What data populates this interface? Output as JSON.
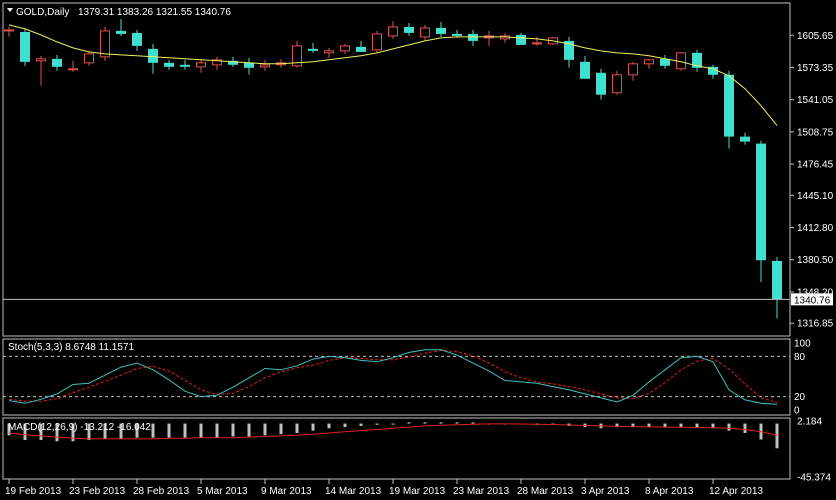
{
  "window": {
    "symbol_header": "GOLD,Daily",
    "ohlc_header": "1379.31 1383.26 1321.55 1340.76"
  },
  "colors": {
    "background": "#000000",
    "grid_frame": "#c0c0c0",
    "bull_candle": "#e05050",
    "bear_candle": "#40e0d0",
    "moving_average": "#f0f060",
    "stoch_main": "#40c0c0",
    "stoch_signal": "#e02020",
    "macd_hist": "#c0c0c0",
    "macd_signal": "#e02020",
    "price_tag_bg": "#ffffff",
    "price_tag_text": "#000000"
  },
  "main_axis": {
    "tick_labels": [
      "1605.65",
      "1573.35",
      "1541.05",
      "1508.75",
      "1476.45",
      "1445.10",
      "1412.80",
      "1380.50",
      "1348.20",
      "1316.85"
    ],
    "tick_values": [
      1605.65,
      1573.35,
      1541.05,
      1508.75,
      1476.45,
      1445.1,
      1412.8,
      1380.5,
      1348.2,
      1316.85
    ],
    "current_price_label": "1340.76",
    "current_price": 1340.76
  },
  "chart_data": {
    "type": "candlestick",
    "title": "GOLD,Daily",
    "subtitle": "1379.31 1383.26 1321.55 1340.76",
    "x_tick_labels": [
      "19 Feb 2013",
      "23 Feb 2013",
      "28 Feb 2013",
      "5 Mar 2013",
      "9 Mar 2013",
      "14 Mar 2013",
      "19 Mar 2013",
      "23 Mar 2013",
      "28 Mar 2013",
      "3 Apr 2013",
      "8 Apr 2013",
      "12 Apr 2013"
    ],
    "x_tick_index": [
      0,
      4,
      8,
      12,
      16,
      20,
      24,
      28,
      32,
      36,
      40,
      44
    ],
    "ylim": [
      1306,
      1635
    ],
    "candles": [
      {
        "o": 1610,
        "h": 1614,
        "l": 1604,
        "c": 1611
      },
      {
        "o": 1609,
        "h": 1612,
        "l": 1575,
        "c": 1579
      },
      {
        "o": 1580,
        "h": 1585,
        "l": 1555,
        "c": 1582
      },
      {
        "o": 1582,
        "h": 1586,
        "l": 1570,
        "c": 1574
      },
      {
        "o": 1572,
        "h": 1580,
        "l": 1569,
        "c": 1572
      },
      {
        "o": 1578,
        "h": 1590,
        "l": 1575,
        "c": 1587
      },
      {
        "o": 1584,
        "h": 1614,
        "l": 1580,
        "c": 1610
      },
      {
        "o": 1610,
        "h": 1622,
        "l": 1605,
        "c": 1607
      },
      {
        "o": 1608,
        "h": 1611,
        "l": 1590,
        "c": 1595
      },
      {
        "o": 1592,
        "h": 1597,
        "l": 1567,
        "c": 1578
      },
      {
        "o": 1578,
        "h": 1581,
        "l": 1571,
        "c": 1574
      },
      {
        "o": 1576,
        "h": 1581,
        "l": 1571,
        "c": 1574
      },
      {
        "o": 1574,
        "h": 1581,
        "l": 1568,
        "c": 1578
      },
      {
        "o": 1576,
        "h": 1584,
        "l": 1571,
        "c": 1581
      },
      {
        "o": 1580,
        "h": 1584,
        "l": 1574,
        "c": 1576
      },
      {
        "o": 1578,
        "h": 1583,
        "l": 1566,
        "c": 1573
      },
      {
        "o": 1574,
        "h": 1581,
        "l": 1570,
        "c": 1576
      },
      {
        "o": 1576,
        "h": 1582,
        "l": 1573,
        "c": 1578
      },
      {
        "o": 1575,
        "h": 1600,
        "l": 1573,
        "c": 1595
      },
      {
        "o": 1592,
        "h": 1598,
        "l": 1588,
        "c": 1590
      },
      {
        "o": 1588,
        "h": 1593,
        "l": 1583,
        "c": 1590
      },
      {
        "o": 1590,
        "h": 1597,
        "l": 1587,
        "c": 1595
      },
      {
        "o": 1594,
        "h": 1600,
        "l": 1589,
        "c": 1589
      },
      {
        "o": 1591,
        "h": 1610,
        "l": 1588,
        "c": 1607
      },
      {
        "o": 1605,
        "h": 1620,
        "l": 1602,
        "c": 1614
      },
      {
        "o": 1614,
        "h": 1618,
        "l": 1605,
        "c": 1608
      },
      {
        "o": 1604,
        "h": 1616,
        "l": 1600,
        "c": 1613
      },
      {
        "o": 1613,
        "h": 1619,
        "l": 1604,
        "c": 1607
      },
      {
        "o": 1607,
        "h": 1611,
        "l": 1603,
        "c": 1605
      },
      {
        "o": 1607,
        "h": 1611,
        "l": 1595,
        "c": 1600
      },
      {
        "o": 1603,
        "h": 1610,
        "l": 1595,
        "c": 1605
      },
      {
        "o": 1602,
        "h": 1608,
        "l": 1598,
        "c": 1605
      },
      {
        "o": 1606,
        "h": 1608,
        "l": 1596,
        "c": 1596
      },
      {
        "o": 1597,
        "h": 1604,
        "l": 1595,
        "c": 1598
      },
      {
        "o": 1597,
        "h": 1604,
        "l": 1596,
        "c": 1603
      },
      {
        "o": 1600,
        "h": 1604,
        "l": 1573,
        "c": 1581
      },
      {
        "o": 1579,
        "h": 1585,
        "l": 1562,
        "c": 1562
      },
      {
        "o": 1568,
        "h": 1572,
        "l": 1541,
        "c": 1546
      },
      {
        "o": 1548,
        "h": 1570,
        "l": 1546,
        "c": 1566
      },
      {
        "o": 1566,
        "h": 1579,
        "l": 1560,
        "c": 1577
      },
      {
        "o": 1577,
        "h": 1582,
        "l": 1572,
        "c": 1581
      },
      {
        "o": 1582,
        "h": 1586,
        "l": 1572,
        "c": 1575
      },
      {
        "o": 1572,
        "h": 1589,
        "l": 1570,
        "c": 1588
      },
      {
        "o": 1588,
        "h": 1591,
        "l": 1569,
        "c": 1573
      },
      {
        "o": 1574,
        "h": 1576,
        "l": 1562,
        "c": 1566
      },
      {
        "o": 1566,
        "h": 1570,
        "l": 1492,
        "c": 1504
      },
      {
        "o": 1504,
        "h": 1508,
        "l": 1496,
        "c": 1499
      },
      {
        "o": 1497,
        "h": 1500,
        "l": 1358,
        "c": 1380
      },
      {
        "o": 1379.31,
        "h": 1383.26,
        "l": 1321.55,
        "c": 1340.76
      }
    ],
    "ma": [
      1616,
      1612,
      1606,
      1599,
      1593,
      1589,
      1587,
      1586,
      1585,
      1584,
      1583,
      1582,
      1581,
      1580,
      1579,
      1578,
      1577,
      1577,
      1578,
      1579,
      1581,
      1583,
      1585,
      1588,
      1592,
      1596,
      1600,
      1603,
      1604,
      1604,
      1604,
      1604,
      1603,
      1602,
      1600,
      1597,
      1593,
      1590,
      1588,
      1587,
      1585,
      1582,
      1579,
      1575,
      1572,
      1565,
      1552,
      1535,
      1515
    ],
    "stoch": {
      "label": "Stoch(5,3,3) 8.6748 11.1571",
      "axis_labels": [
        "100",
        "80",
        "20",
        "0"
      ],
      "axis_values": [
        100,
        80,
        20,
        0
      ],
      "levels": [
        80,
        20
      ],
      "main": [
        14,
        10,
        16,
        24,
        38,
        40,
        52,
        64,
        70,
        60,
        45,
        28,
        20,
        22,
        34,
        48,
        62,
        60,
        66,
        76,
        80,
        78,
        74,
        72,
        78,
        86,
        90,
        90,
        82,
        70,
        58,
        44,
        42,
        40,
        35,
        30,
        24,
        18,
        12,
        22,
        42,
        60,
        78,
        80,
        72,
        30,
        15,
        10,
        8.67
      ],
      "signal": [
        16,
        13,
        13,
        17,
        26,
        34,
        43,
        52,
        62,
        65,
        58,
        44,
        30,
        23,
        25,
        35,
        48,
        57,
        63,
        67,
        74,
        78,
        77,
        75,
        75,
        79,
        85,
        89,
        87,
        81,
        70,
        57,
        48,
        42,
        39,
        35,
        30,
        24,
        18,
        17,
        25,
        41,
        60,
        73,
        77,
        61,
        39,
        18,
        11.16
      ]
    },
    "macd": {
      "label": "MACD(12,26,9) -13.212 -16.042",
      "axis_labels": [
        "2.184",
        "-45.374"
      ],
      "axis_values": [
        2.184,
        -45.374
      ],
      "hist": [
        -10,
        -14,
        -14,
        -15,
        -15,
        -14,
        -13,
        -13,
        -12,
        -12,
        -12,
        -12,
        -12,
        -12,
        -11,
        -11,
        -10,
        -9,
        -8,
        -6,
        -4,
        -3,
        -2,
        -1,
        0,
        1,
        1,
        1,
        1,
        1,
        0,
        0,
        0,
        -1,
        -1,
        -2,
        -3,
        -4,
        -3,
        -3,
        -3,
        -3,
        -3,
        -3,
        -4,
        -6,
        -8,
        -13.5,
        -21
      ],
      "signal": [
        -8,
        -9.5,
        -10.5,
        -11.5,
        -12.5,
        -13,
        -13,
        -13,
        -13,
        -13,
        -12.5,
        -12.5,
        -12,
        -12,
        -12,
        -11.5,
        -11,
        -10.5,
        -10,
        -9,
        -8,
        -7,
        -6,
        -5,
        -4,
        -3,
        -2,
        -1.5,
        -1,
        -0.5,
        -0.3,
        -0.3,
        -0.4,
        -0.5,
        -0.8,
        -1.2,
        -1.6,
        -2,
        -2.4,
        -2.6,
        -2.8,
        -3,
        -3.1,
        -3.3,
        -3.5,
        -4,
        -5,
        -7,
        -10
      ]
    }
  }
}
